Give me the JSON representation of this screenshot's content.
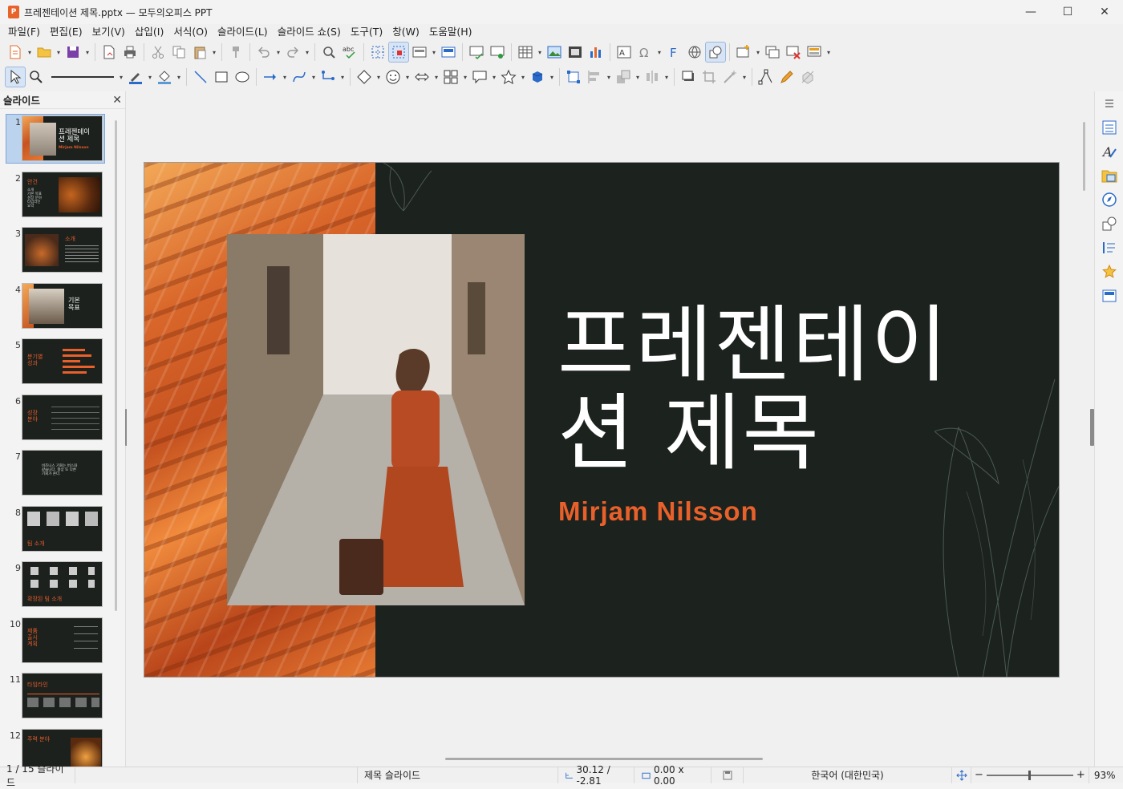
{
  "window": {
    "title": "프레젠테이션 제목.pptx — 모두의오피스 PPT",
    "minimize": "—",
    "maximize": "☐",
    "close": "✕"
  },
  "menu": [
    "파일(F)",
    "편집(E)",
    "보기(V)",
    "삽입(I)",
    "서식(O)",
    "슬라이드(L)",
    "슬라이드 쇼(S)",
    "도구(T)",
    "창(W)",
    "도움말(H)"
  ],
  "slide_panel": {
    "header": "슬라이드",
    "close": "✕",
    "thumbnails": [
      {
        "num": "1",
        "title": "프레젠테이\n션 제목",
        "sub": "Mirjam Nilsson"
      },
      {
        "num": "2",
        "title": "안건",
        "lines": "소개\n기본 목표\n성장 분야\n타임라인\n요약"
      },
      {
        "num": "3",
        "title": "소개",
        "lines": ""
      },
      {
        "num": "4",
        "title": "기본\n목표",
        "lines": ""
      },
      {
        "num": "5",
        "title": "분기별\n성과",
        "lines": ""
      },
      {
        "num": "6",
        "title": "성장\n분야",
        "lines": ""
      },
      {
        "num": "7",
        "title": "",
        "lines": "비즈니스 기회는 버스와\n같습니다. 항상 또 다른\n기회가 온다."
      },
      {
        "num": "8",
        "title": "팀 소개",
        "lines": ""
      },
      {
        "num": "9",
        "title": "확장된 팀 소개",
        "lines": ""
      },
      {
        "num": "10",
        "title": "제품\n출시\n계획",
        "lines": ""
      },
      {
        "num": "11",
        "title": "타임라인",
        "lines": ""
      },
      {
        "num": "12",
        "title": "주력 분야",
        "lines": ""
      }
    ]
  },
  "slide": {
    "title_line1": "프레젠테이",
    "title_line2": "션 제목",
    "subtitle": "Mirjam Nilsson"
  },
  "status": {
    "slide_count": "1 / 15 슬라이드",
    "layout": "제목 슬라이드",
    "position": "30.12 / -2.81",
    "size": "0.00 x 0.00",
    "language": "한국어 (대한민국)",
    "zoom": "93%"
  },
  "colors": {
    "accent": "#e8602a",
    "slide_bg": "#1c221e",
    "selection": "#bcd3ee"
  }
}
